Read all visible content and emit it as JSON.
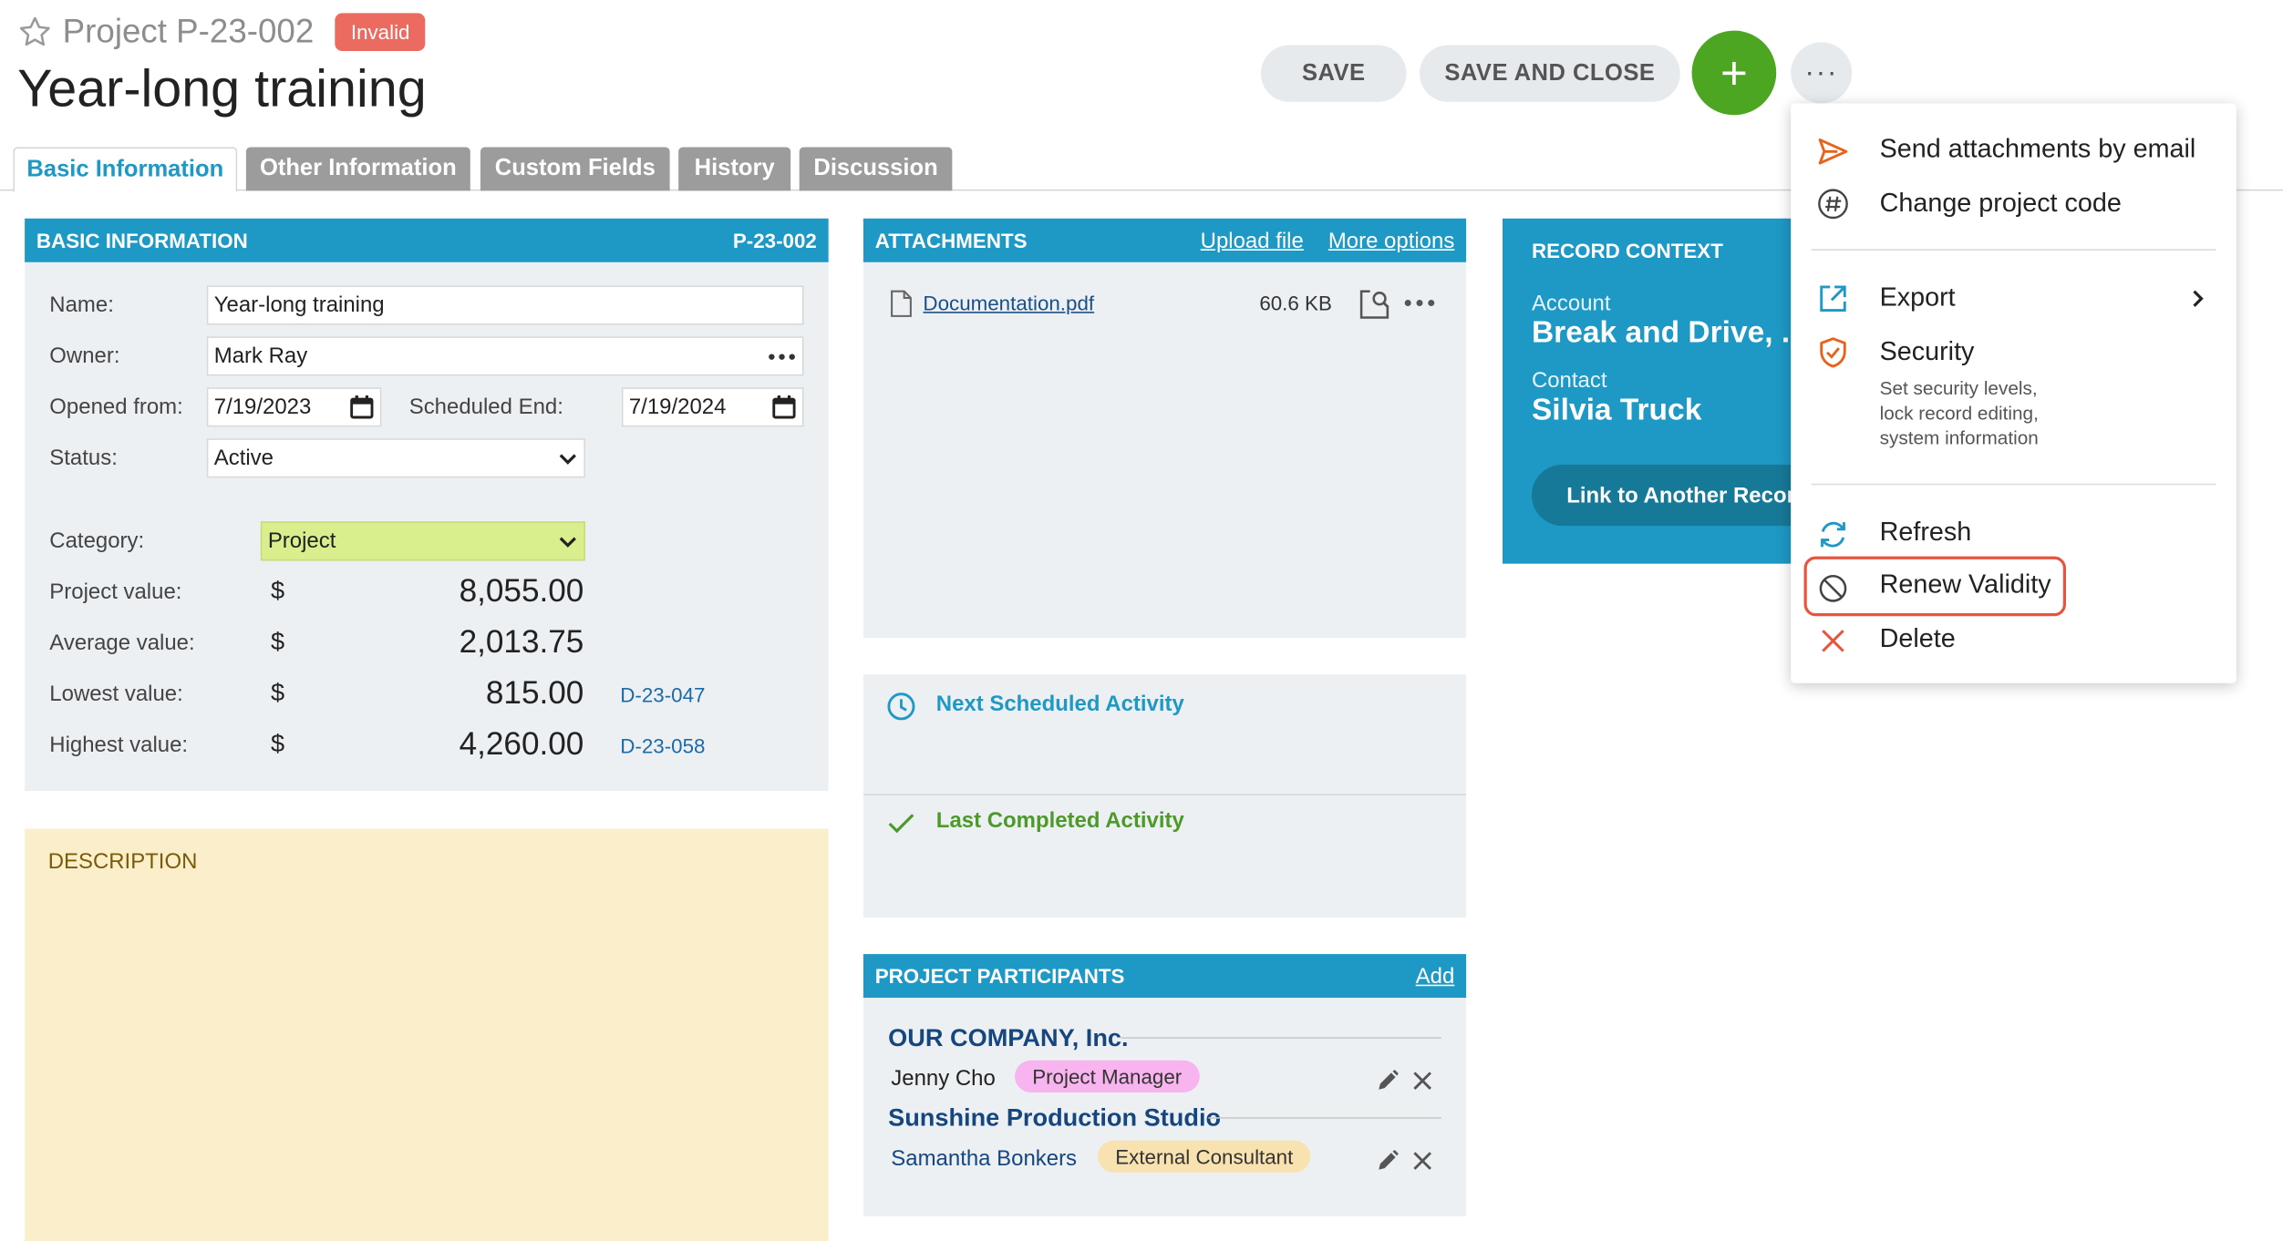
{
  "header": {
    "project_code": "Project P-23-002",
    "status_badge": "Invalid",
    "title": "Year-long training"
  },
  "toolbar": {
    "save_label": "SAVE",
    "save_close_label": "SAVE AND CLOSE",
    "add_label": "+",
    "more_label": "···"
  },
  "tabs": [
    {
      "label": "Basic Information",
      "active": true
    },
    {
      "label": "Other Information",
      "active": false
    },
    {
      "label": "Custom Fields",
      "active": false
    },
    {
      "label": "History",
      "active": false
    },
    {
      "label": "Discussion",
      "active": false
    }
  ],
  "basic_info": {
    "heading": "BASIC INFORMATION",
    "code": "P-23-002",
    "name_label": "Name:",
    "name_value": "Year-long training",
    "owner_label": "Owner:",
    "owner_value": "Mark Ray",
    "opened_label": "Opened from:",
    "opened_value": "7/19/2023",
    "sched_end_label": "Scheduled End:",
    "sched_end_value": "7/19/2024",
    "status_label": "Status:",
    "status_value": "Active",
    "category_label": "Category:",
    "category_value": "Project",
    "values": [
      {
        "label": "Project value:",
        "currency": "$",
        "amount": "8,055.00",
        "ref": ""
      },
      {
        "label": "Average value:",
        "currency": "$",
        "amount": "2,013.75",
        "ref": ""
      },
      {
        "label": "Lowest value:",
        "currency": "$",
        "amount": "815.00",
        "ref": "D-23-047"
      },
      {
        "label": "Highest value:",
        "currency": "$",
        "amount": "4,260.00",
        "ref": "D-23-058"
      }
    ]
  },
  "description": {
    "heading": "DESCRIPTION"
  },
  "attachments": {
    "heading": "ATTACHMENTS",
    "upload_link": "Upload file",
    "more_link": "More options",
    "files": [
      {
        "name": "Documentation.pdf",
        "size": "60.6 KB"
      }
    ]
  },
  "activities": {
    "next_label": "Next Scheduled Activity",
    "last_label": "Last Completed Activity",
    "next_color": "#1e98c4",
    "last_color": "#4d9a2a"
  },
  "participants": {
    "heading": "PROJECT PARTICIPANTS",
    "add_link": "Add",
    "groups": [
      {
        "org": "OUR COMPANY, Inc.",
        "person": "Jenny Cho",
        "role": "Project Manager",
        "role_color": "#f7b4ee"
      },
      {
        "org": "Sunshine Production Studio",
        "person": "Samantha Bonkers",
        "role": "External Consultant",
        "role_color": "#f8e2b0"
      }
    ]
  },
  "record_context": {
    "heading": "RECORD CONTEXT",
    "account_label": "Account",
    "account_value": "Break and Drive, ...",
    "contact_label": "Contact",
    "contact_value": "Silvia Truck",
    "link_button": "Link to Another Record"
  },
  "menu": {
    "items": [
      {
        "label": "Send attachments by email",
        "icon": "send-icon"
      },
      {
        "label": "Change project code",
        "icon": "hash-icon"
      },
      {
        "label": "Export",
        "icon": "export-icon"
      },
      {
        "label": "Security",
        "icon": "shield-icon",
        "sub": [
          "Set security levels,",
          "lock record editing,",
          "system information"
        ]
      },
      {
        "label": "Refresh",
        "icon": "refresh-icon"
      },
      {
        "label": "Renew Validity",
        "icon": "ban-icon",
        "highlighted": true
      },
      {
        "label": "Delete",
        "icon": "close-icon"
      }
    ]
  },
  "colors": {
    "accent": "#1e98c4",
    "primary_green": "#4ca622",
    "invalid_red": "#ec6b60",
    "icon_orange": "#e8621c",
    "highlight_border": "#e8553f"
  }
}
